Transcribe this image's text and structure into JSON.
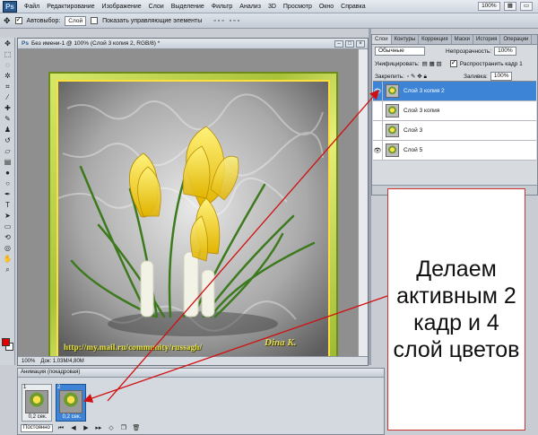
{
  "app": {
    "logo": "Ps",
    "menu": [
      "Файл",
      "Редактирование",
      "Изображение",
      "Слои",
      "Выделение",
      "Фильтр",
      "Анализ",
      "3D",
      "Просмотр",
      "Окно",
      "Справка"
    ],
    "zoom": "100%"
  },
  "options_bar": {
    "autoselect_label": "Автовыбор:",
    "autoselect_value": "Слой",
    "show_controls_label": "Показать управляющие элементы"
  },
  "document": {
    "title": "Без имени-1 @ 100% (Слой 3 копия 2, RGB/8) *",
    "zoom": "100%",
    "doc_info": "Док: 1,03M/4,80M",
    "watermark_url": "http://my.mail.ru/community/russagh/",
    "signature": "Dina K."
  },
  "layers_panel": {
    "tabs": [
      "Слои",
      "Контуры",
      "Коррекция",
      "Маски",
      "История",
      "Операции"
    ],
    "blend_mode": "Обычные",
    "opacity_label": "Непрозрачность:",
    "opacity_value": "100%",
    "unify_label": "Унифицировать:",
    "propagate_label": "Распространить кадр 1",
    "lock_label": "Закрепить:",
    "fill_label": "Заливка:",
    "fill_value": "100%",
    "layers": [
      {
        "name": "Слой 3 копия 2",
        "visible": true,
        "active": true
      },
      {
        "name": "Слой 3 копия",
        "visible": false,
        "active": false
      },
      {
        "name": "Слой 3",
        "visible": false,
        "active": false
      },
      {
        "name": "Слой 5",
        "visible": true,
        "active": false
      }
    ]
  },
  "animation_panel": {
    "title": "Анимация (покадровая)",
    "frames": [
      {
        "number": "1",
        "delay": "0,2 сек.",
        "selected": false
      },
      {
        "number": "2",
        "delay": "0,2 сек.",
        "selected": true
      }
    ],
    "loop": "Постоянно"
  },
  "callout": {
    "text": "Делаем активным 2 кадр и 4 слой цветов"
  },
  "colors": {
    "accent_selection": "#3d84d6",
    "arrow": "#d01010",
    "foreground_swatch": "#e00000"
  }
}
